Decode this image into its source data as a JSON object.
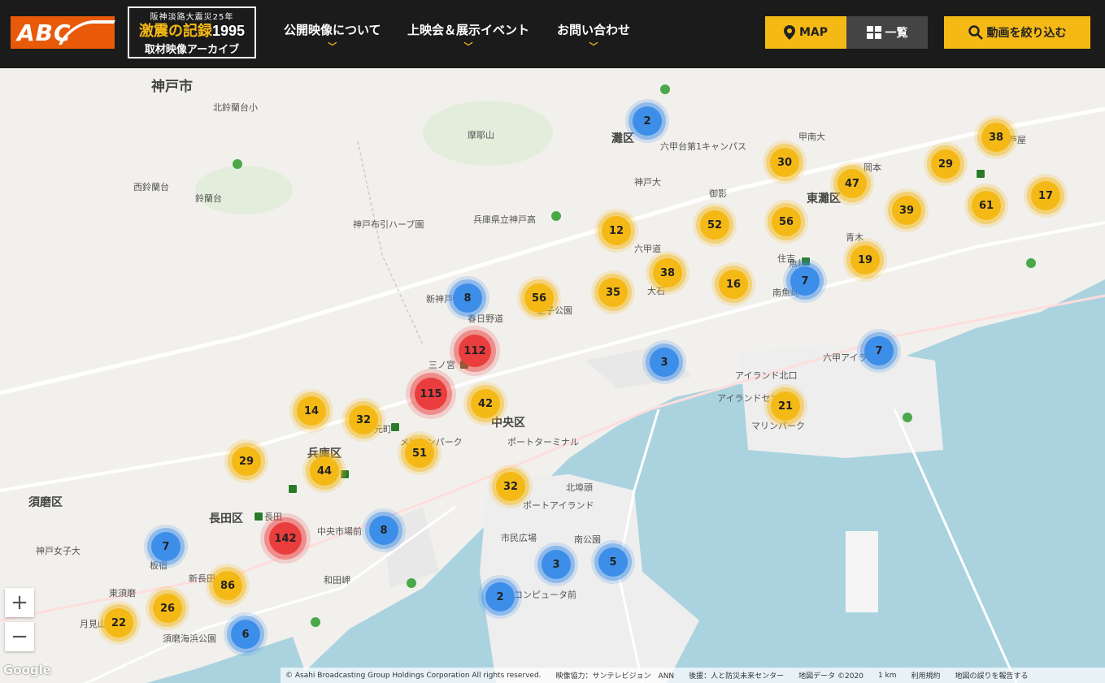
{
  "header": {
    "logo_text": "ABC",
    "archive_sub": "阪神淡路大震災25年",
    "archive_title": "激震の記録",
    "archive_year": "1995",
    "archive_bottom": "取材映像アーカイブ",
    "nav": [
      "公開映像について",
      "上映会＆展示イベント",
      "お問い合わせ"
    ],
    "btn_map": "MAP",
    "btn_list": "一覧",
    "btn_filter": "動画を絞り込む"
  },
  "map_labels": {
    "kobe_city": "神戸市",
    "nada_ku": "灘区",
    "higashinada_ku": "東灘区",
    "chuo_ku": "中央区",
    "hyogo_ku": "兵庫区",
    "nagata_ku": "長田区",
    "suma_ku": "須磨区",
    "maya_san": "摩耶山",
    "kitasuzurandai": "北鈴蘭台小",
    "suzurandai": "鈴蘭台",
    "nishi_suzurandai": "西鈴蘭台",
    "shin_kobe": "新神戸",
    "sannomiya": "三ノ宮",
    "kasuga": "春日野道",
    "motomachi": "元町",
    "port_island": "ポートアイランド",
    "rokko_island": "六甲アイランド",
    "meriken": "メリケンパーク",
    "hyogo_pref_kobe_high": "兵庫県立神戸高",
    "habu": "神戸布引ハーブ園",
    "rokkodai": "六甲台第1キャンパス",
    "kobe_univ": "神戸大",
    "rokkomichi": "六甲道",
    "mikage": "御影",
    "sumiyoshi": "住吉",
    "okamoto": "岡本",
    "ashiya": "芦屋",
    "minami_uozaki": "南魚崎",
    "port_terminal": "ポートターミナル",
    "shimin_hiroba": "市民広場",
    "kita_futo": "北埠頭",
    "minami_koen": "南公園",
    "computer_mae": "コンピュータ前",
    "wadamisaki": "和田岬",
    "chuo_ichiba": "中央市場前",
    "nagata": "長田",
    "shin_nagata": "新長田",
    "itayado": "板宿",
    "suma_kaihin": "須磨海浜公園",
    "higashi_suma": "東須磨",
    "tsukimiyama": "月見山",
    "kobe_joshi": "神戸女子大",
    "island_kita": "アイランド北口",
    "island_center": "アイランドセンター",
    "marine_park": "マリンパーク",
    "kodai_nishi": "甲南大",
    "uozaki": "魚崎",
    "aoki": "青木",
    "oishi": "大石",
    "oji_koen": "王子公園"
  },
  "clusters": [
    {
      "count": "2",
      "color": "b"
    },
    {
      "count": "30",
      "color": "y"
    },
    {
      "count": "38",
      "color": "y"
    },
    {
      "count": "29",
      "color": "y"
    },
    {
      "count": "47",
      "color": "y"
    },
    {
      "count": "39",
      "color": "y"
    },
    {
      "count": "61",
      "color": "y"
    },
    {
      "count": "17",
      "color": "y"
    },
    {
      "count": "12",
      "color": "y"
    },
    {
      "count": "52",
      "color": "y"
    },
    {
      "count": "56",
      "color": "y"
    },
    {
      "count": "38",
      "color": "y"
    },
    {
      "count": "35",
      "color": "y"
    },
    {
      "count": "16",
      "color": "y"
    },
    {
      "count": "19",
      "color": "y"
    },
    {
      "count": "7",
      "color": "b"
    },
    {
      "count": "8",
      "color": "b"
    },
    {
      "count": "56",
      "color": "y"
    },
    {
      "count": "112",
      "color": "r"
    },
    {
      "count": "3",
      "color": "b"
    },
    {
      "count": "7",
      "color": "b"
    },
    {
      "count": "115",
      "color": "r"
    },
    {
      "count": "42",
      "color": "y"
    },
    {
      "count": "14",
      "color": "y"
    },
    {
      "count": "32",
      "color": "y"
    },
    {
      "count": "21",
      "color": "y"
    },
    {
      "count": "51",
      "color": "y"
    },
    {
      "count": "29",
      "color": "y"
    },
    {
      "count": "44",
      "color": "y"
    },
    {
      "count": "32",
      "color": "y"
    },
    {
      "count": "8",
      "color": "b"
    },
    {
      "count": "142",
      "color": "r"
    },
    {
      "count": "7",
      "color": "b"
    },
    {
      "count": "3",
      "color": "b"
    },
    {
      "count": "5",
      "color": "b"
    },
    {
      "count": "86",
      "color": "y"
    },
    {
      "count": "2",
      "color": "b"
    },
    {
      "count": "26",
      "color": "y"
    },
    {
      "count": "22",
      "color": "y"
    },
    {
      "count": "6",
      "color": "b"
    }
  ],
  "zoom": {
    "in": "+",
    "out": "−"
  },
  "footer": {
    "copyright": "© Asahi Broadcasting Group Holdings Corporation All rights reserved.",
    "cooperation": "映像協力：サンテレビジョン　ANN",
    "support": "後援：人と防災未来センター",
    "map_data": "地図データ ©2020",
    "scale": "1 km",
    "terms": "利用規約",
    "report": "地図の誤りを報告する",
    "google": "Google"
  },
  "colors": {
    "accent": "#f5b915",
    "header_bg": "#1b1b1b",
    "cluster_red": "#ea3d3d",
    "cluster_blue": "#3d8ee8",
    "sea": "#aad3df"
  }
}
